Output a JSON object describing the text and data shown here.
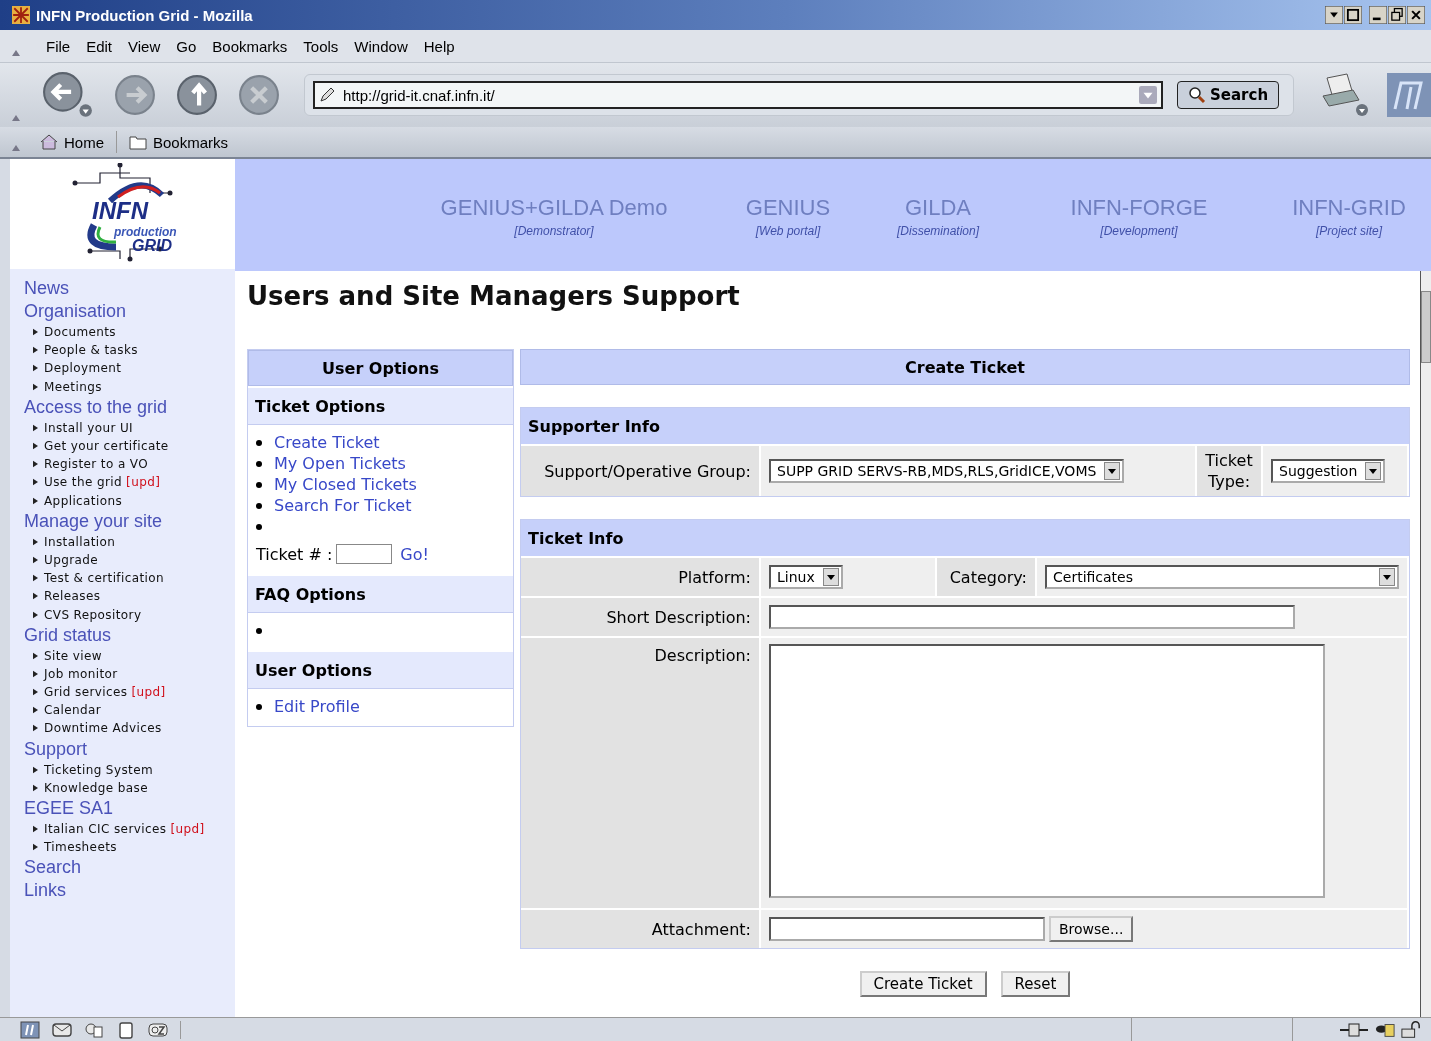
{
  "window": {
    "title": "INFN Production Grid - Mozilla"
  },
  "menu": [
    "File",
    "Edit",
    "View",
    "Go",
    "Bookmarks",
    "Tools",
    "Window",
    "Help"
  ],
  "toolbar": {
    "url": "http://grid-it.cnaf.infn.it/",
    "search": "Search"
  },
  "bookmarks_bar": [
    "Home",
    "Bookmarks"
  ],
  "logo": {
    "line1": "INFN",
    "line2": "production",
    "line3": "GRID"
  },
  "header_links": [
    {
      "title": "GENIUS+GILDA Demo",
      "subtitle": "[Demonstrator]"
    },
    {
      "title": "GENIUS",
      "subtitle": "[Web portal]"
    },
    {
      "title": "GILDA",
      "subtitle": "[Dissemination]"
    },
    {
      "title": "INFN-FORGE",
      "subtitle": "[Development]"
    },
    {
      "title": "INFN-GRID",
      "subtitle": "[Project site]"
    }
  ],
  "sidebar": [
    {
      "label": "News"
    },
    {
      "label": "Organisation",
      "children": [
        {
          "label": "Documents"
        },
        {
          "label": "People & tasks"
        },
        {
          "label": "Deployment"
        },
        {
          "label": "Meetings"
        }
      ]
    },
    {
      "label": "Access to the grid",
      "children": [
        {
          "label": "Install your UI"
        },
        {
          "label": "Get your certificate"
        },
        {
          "label": "Register to a VO"
        },
        {
          "label": "Use the grid",
          "badge": "[upd]"
        },
        {
          "label": "Applications"
        }
      ]
    },
    {
      "label": "Manage your site",
      "children": [
        {
          "label": "Installation"
        },
        {
          "label": "Upgrade"
        },
        {
          "label": "Test & certification"
        },
        {
          "label": "Releases"
        },
        {
          "label": "CVS Repository"
        }
      ]
    },
    {
      "label": "Grid status",
      "children": [
        {
          "label": "Site view"
        },
        {
          "label": "Job monitor"
        },
        {
          "label": "Grid services",
          "badge": "[upd]"
        },
        {
          "label": "Calendar"
        },
        {
          "label": "Downtime Advices"
        }
      ]
    },
    {
      "label": "Support",
      "children": [
        {
          "label": "Ticketing System"
        },
        {
          "label": "Knowledge base"
        }
      ]
    },
    {
      "label": "EGEE SA1",
      "children": [
        {
          "label": "Italian CIC services",
          "badge": "[upd]"
        },
        {
          "label": "Timesheets"
        }
      ]
    },
    {
      "label": "Search"
    },
    {
      "label": "Links"
    }
  ],
  "page_title": "Users and Site Managers Support",
  "user_options": {
    "header": "User Options",
    "sections": [
      {
        "title": "Ticket Options",
        "items": [
          {
            "kind": "link",
            "label": "Create Ticket"
          },
          {
            "kind": "link",
            "label": "My Open Tickets"
          },
          {
            "kind": "link",
            "label": "My Closed Tickets"
          },
          {
            "kind": "link",
            "label": "Search For Ticket"
          },
          {
            "kind": "empty"
          }
        ],
        "ticket_lookup": {
          "label": "Ticket # :",
          "go": "Go!"
        }
      },
      {
        "title": "FAQ Options",
        "items": [
          {
            "kind": "empty"
          }
        ]
      },
      {
        "title": "User Options",
        "items": [
          {
            "kind": "link",
            "label": "Edit Profile"
          }
        ]
      }
    ]
  },
  "create_ticket": {
    "header": "Create Ticket",
    "supporter_info": {
      "title": "Supporter Info",
      "group_label": "Support/Operative Group:",
      "group_value": "SUPP GRID SERVS-RB,MDS,RLS,GridICE,VOMS",
      "type_label": "Ticket Type:",
      "type_value": "Suggestion"
    },
    "ticket_info": {
      "title": "Ticket Info",
      "platform_label": "Platform:",
      "platform_value": "Linux",
      "category_label": "Category:",
      "category_value": "Certificates",
      "short_description_label": "Short Description:",
      "description_label": "Description:",
      "attachment_label": "Attachment:",
      "browse": "Browse..."
    },
    "buttons": [
      "Create Ticket",
      "Reset"
    ]
  }
}
